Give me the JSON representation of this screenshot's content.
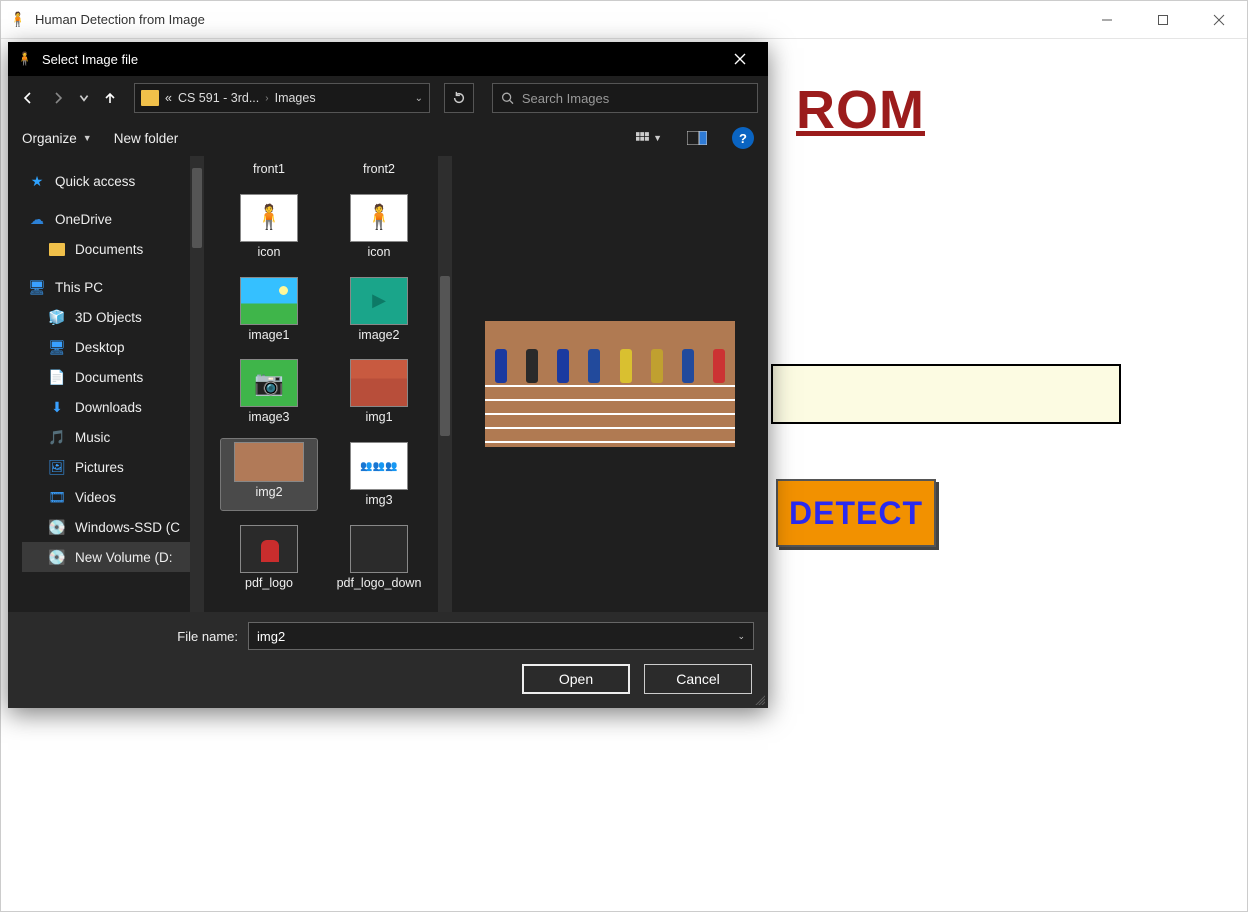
{
  "main_window": {
    "title": "Human Detection from Image",
    "heading_fragment": "ROM",
    "detect_label": "DETECT"
  },
  "dialog": {
    "title": "Select Image file",
    "breadcrumb": {
      "root_prefix": "«",
      "crumb1": "CS 591 - 3rd...",
      "crumb2": "Images"
    },
    "search_placeholder": "Search Images",
    "toolbar": {
      "organize": "Organize",
      "new_folder": "New folder"
    },
    "nav_items": [
      {
        "label": "Quick access",
        "icon": "star",
        "sub": false
      },
      {
        "label": "OneDrive",
        "icon": "cloud",
        "sub": false
      },
      {
        "label": "Documents",
        "icon": "folder",
        "sub": true
      },
      {
        "label": "This PC",
        "icon": "pc",
        "sub": false
      },
      {
        "label": "3D Objects",
        "icon": "blue",
        "sub": true
      },
      {
        "label": "Desktop",
        "icon": "blue",
        "sub": true
      },
      {
        "label": "Documents",
        "icon": "blue",
        "sub": true
      },
      {
        "label": "Downloads",
        "icon": "blue",
        "sub": true
      },
      {
        "label": "Music",
        "icon": "blue",
        "sub": true
      },
      {
        "label": "Pictures",
        "icon": "blue",
        "sub": true
      },
      {
        "label": "Videos",
        "icon": "blue",
        "sub": true
      },
      {
        "label": "Windows-SSD (C",
        "icon": "disk",
        "sub": true
      },
      {
        "label": "New Volume (D:",
        "icon": "disk",
        "sub": true,
        "selected": true
      }
    ],
    "files": [
      {
        "label": "front1",
        "thumb": "none",
        "label_only_top": true
      },
      {
        "label": "front2",
        "thumb": "none",
        "label_only_top": true
      },
      {
        "label": "icon",
        "thumb": "icon"
      },
      {
        "label": "icon",
        "thumb": "icon"
      },
      {
        "label": "image1",
        "thumb": "image1"
      },
      {
        "label": "image2",
        "thumb": "image2"
      },
      {
        "label": "image3",
        "thumb": "image3"
      },
      {
        "label": "img1",
        "thumb": "img1"
      },
      {
        "label": "img2",
        "thumb": "img2",
        "selected": true
      },
      {
        "label": "img3",
        "thumb": "img3"
      },
      {
        "label": "pdf_logo",
        "thumb": "pdfl"
      },
      {
        "label": "pdf_logo_down",
        "thumb": "pdfl2"
      }
    ],
    "file_name_label": "File name:",
    "file_name_value": "img2",
    "open_label": "Open",
    "cancel_label": "Cancel",
    "help_glyph": "?"
  }
}
